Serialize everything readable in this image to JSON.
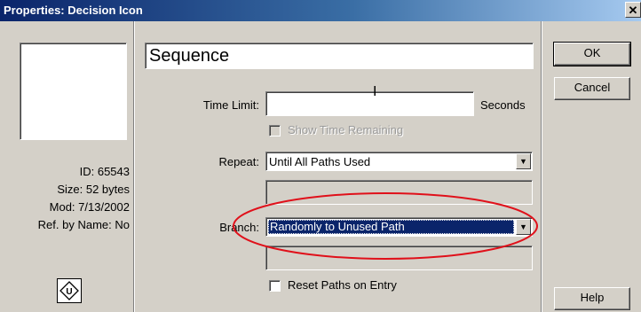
{
  "window": {
    "title": "Properties: Decision Icon",
    "close_glyph": "✕"
  },
  "info": {
    "id": "ID: 65543",
    "size": "Size: 52 bytes",
    "mod": "Mod: 7/13/2002",
    "ref": "Ref. by Name: No"
  },
  "icon": {
    "name": "decision-icon",
    "glyph": "U"
  },
  "form": {
    "name_value": "Sequence",
    "time_limit_label": "Time Limit:",
    "time_limit_value": "",
    "time_limit_unit": "Seconds",
    "show_time_remaining_label": "Show Time Remaining",
    "show_time_remaining_checked": false,
    "repeat_label": "Repeat:",
    "repeat_value": "Until All Paths Used",
    "repeat_extra_value": "",
    "branch_label": "Branch:",
    "branch_value": "Randomly to Unused Path",
    "branch_extra_value": "",
    "reset_paths_label": "Reset Paths on Entry",
    "reset_paths_checked": false
  },
  "buttons": {
    "ok": "OK",
    "cancel": "Cancel",
    "help": "Help"
  },
  "colors": {
    "annotation": "#e0101a",
    "selection": "#0a246a"
  }
}
